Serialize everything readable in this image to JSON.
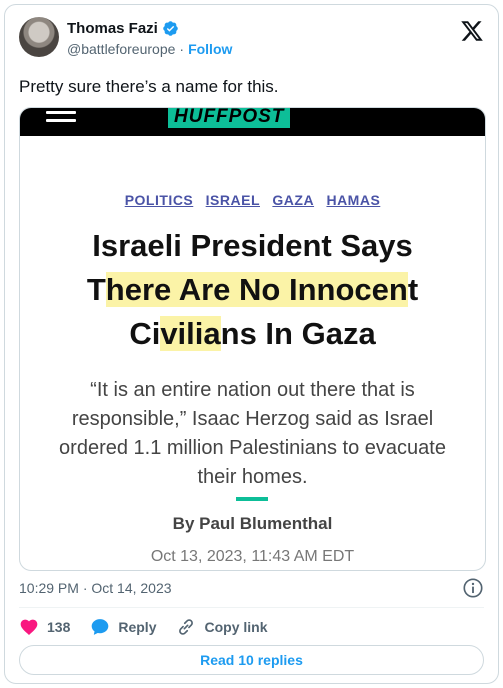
{
  "author": {
    "name": "Thomas Fazi",
    "handle": "@battleforeurope",
    "separator": "·",
    "follow_label": "Follow"
  },
  "tweet": {
    "text": "Pretty sure there’s a name for this.",
    "timestamp": "10:29 PM · Oct 14, 2023"
  },
  "article": {
    "publisher": "HUFFPOST",
    "tags": [
      "POLITICS",
      "ISRAEL",
      "GAZA",
      "HAMAS"
    ],
    "headline_lines": [
      {
        "parts": [
          {
            "text": "Israeli President Says",
            "highlight": false
          }
        ]
      },
      {
        "parts": [
          {
            "text": "T",
            "highlight": false
          },
          {
            "text": "here Are No Innocen",
            "highlight": true
          },
          {
            "text": "t",
            "highlight": false
          }
        ]
      },
      {
        "parts": [
          {
            "text": "Ci",
            "highlight": false
          },
          {
            "text": "vilia",
            "highlight": true
          },
          {
            "text": "ns In Gaza",
            "highlight": false
          }
        ]
      }
    ],
    "dek": "“It is an entire nation out there that is responsible,” Isaac Herzog said as Israel ordered 1.1 million Palestinians to evacuate their homes.",
    "byline": "By Paul Blumenthal",
    "date": "Oct 13, 2023, 11:43 AM EDT"
  },
  "actions": {
    "like_count": "138",
    "reply_label": "Reply",
    "copy_link_label": "Copy link"
  },
  "read_replies_label": "Read 10 replies",
  "colors": {
    "accent": "#1d9bf0",
    "like": "#f91880",
    "huffpost_green": "#0dbe98",
    "highlight": "#fbf3a7"
  },
  "icons": [
    "verified-badge-icon",
    "x-logo-icon",
    "hamburger-icon",
    "info-icon",
    "heart-icon",
    "reply-bubble-icon",
    "link-icon"
  ]
}
